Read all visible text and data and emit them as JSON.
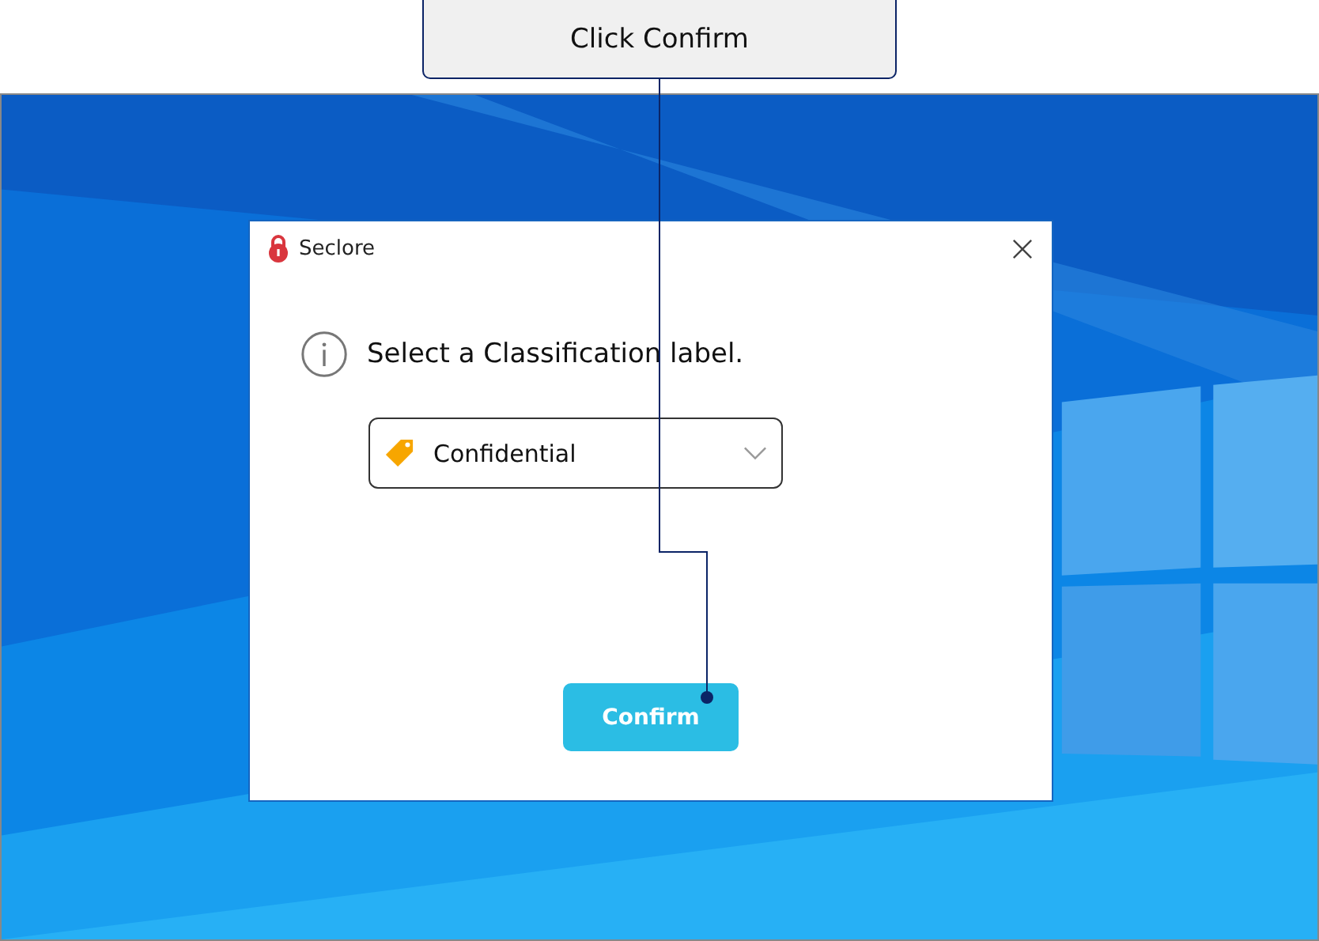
{
  "callout": {
    "text": "Click Confirm"
  },
  "dialog": {
    "title": "Seclore",
    "message": "Select a Classification label.",
    "dropdown": {
      "value": "Confidential"
    },
    "button": "Confirm"
  }
}
